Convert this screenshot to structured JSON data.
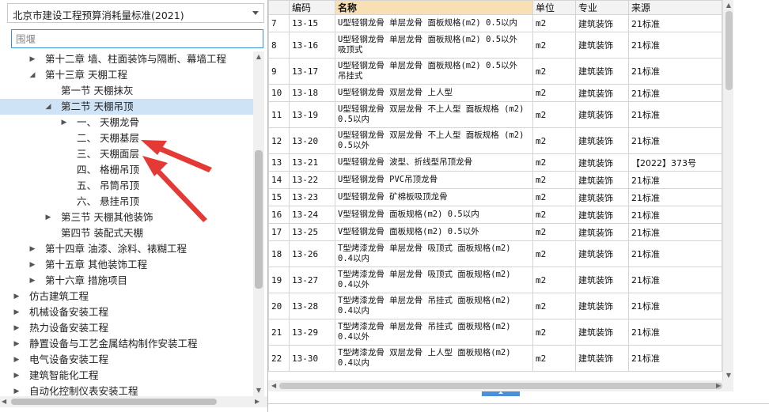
{
  "library_select": {
    "value": "北京市建设工程预算消耗量标准(2021)"
  },
  "search": {
    "placeholder": "围堰",
    "value": ""
  },
  "tree": {
    "items": [
      {
        "label": "第十二章 墙、柱面装饰与隔断、幕墙工程",
        "toggle": "▶",
        "selected": false
      },
      {
        "label": "第十三章 天棚工程",
        "toggle": "◢",
        "selected": false
      },
      {
        "label": "第一节 天棚抹灰",
        "toggle": "",
        "selected": false
      },
      {
        "label": "第二节 天棚吊顶",
        "toggle": "◢",
        "selected": true
      },
      {
        "label": "一、 天棚龙骨",
        "toggle": "▶",
        "selected": false
      },
      {
        "label": "二、 天棚基层",
        "toggle": "",
        "selected": false
      },
      {
        "label": "三、 天棚面层",
        "toggle": "",
        "selected": false
      },
      {
        "label": "四、 格栅吊顶",
        "toggle": "",
        "selected": false
      },
      {
        "label": "五、 吊筒吊顶",
        "toggle": "",
        "selected": false
      },
      {
        "label": "六、 悬挂吊顶",
        "toggle": "",
        "selected": false
      },
      {
        "label": "第三节 天棚其他装饰",
        "toggle": "▶",
        "selected": false
      },
      {
        "label": "第四节 装配式天棚",
        "toggle": "",
        "selected": false
      },
      {
        "label": "第十四章 油漆、涂料、裱糊工程",
        "toggle": "▶",
        "selected": false
      },
      {
        "label": "第十五章 其他装饰工程",
        "toggle": "▶",
        "selected": false
      },
      {
        "label": "第十六章 措施项目",
        "toggle": "▶",
        "selected": false
      },
      {
        "label": "仿古建筑工程",
        "toggle": "▶",
        "selected": false
      },
      {
        "label": "机械设备安装工程",
        "toggle": "▶",
        "selected": false
      },
      {
        "label": "热力设备安装工程",
        "toggle": "▶",
        "selected": false
      },
      {
        "label": "静置设备与工艺金属结构制作安装工程",
        "toggle": "▶",
        "selected": false
      },
      {
        "label": "电气设备安装工程",
        "toggle": "▶",
        "selected": false
      },
      {
        "label": "建筑智能化工程",
        "toggle": "▶",
        "selected": false
      },
      {
        "label": "自动化控制仪表安装工程",
        "toggle": "▶",
        "selected": false
      }
    ]
  },
  "table": {
    "headers": {
      "idx": "",
      "code": "编码",
      "name": "名称",
      "unit": "单位",
      "major": "专业",
      "source": "来源"
    },
    "rows": [
      {
        "idx": "7",
        "code": "13-15",
        "name": "U型轻钢龙骨 单层龙骨 面板规格(m2) 0.5以内",
        "unit": "m2",
        "major": "建筑装饰",
        "source": "21标准"
      },
      {
        "idx": "8",
        "code": "13-16",
        "name": "U型轻钢龙骨 单层龙骨 面板规格(m2) 0.5以外 吸顶式",
        "unit": "m2",
        "major": "建筑装饰",
        "source": "21标准"
      },
      {
        "idx": "9",
        "code": "13-17",
        "name": "U型轻钢龙骨 单层龙骨 面板规格(m2) 0.5以外 吊挂式",
        "unit": "m2",
        "major": "建筑装饰",
        "source": "21标准"
      },
      {
        "idx": "10",
        "code": "13-18",
        "name": "U型轻钢龙骨 双层龙骨 上人型",
        "unit": "m2",
        "major": "建筑装饰",
        "source": "21标准"
      },
      {
        "idx": "11",
        "code": "13-19",
        "name": "U型轻钢龙骨 双层龙骨 不上人型 面板规格 (m2) 0.5以内",
        "unit": "m2",
        "major": "建筑装饰",
        "source": "21标准"
      },
      {
        "idx": "12",
        "code": "13-20",
        "name": "U型轻钢龙骨 双层龙骨 不上人型 面板规格 (m2) 0.5以外",
        "unit": "m2",
        "major": "建筑装饰",
        "source": "21标准"
      },
      {
        "idx": "13",
        "code": "13-21",
        "name": "U型轻钢龙骨 波型、折线型吊顶龙骨",
        "unit": "m2",
        "major": "建筑装饰",
        "source": "【2022】373号"
      },
      {
        "idx": "14",
        "code": "13-22",
        "name": "U型轻钢龙骨 PVC吊顶龙骨",
        "unit": "m2",
        "major": "建筑装饰",
        "source": "21标准"
      },
      {
        "idx": "15",
        "code": "13-23",
        "name": "U型轻钢龙骨 矿棉板吸顶龙骨",
        "unit": "m2",
        "major": "建筑装饰",
        "source": "21标准"
      },
      {
        "idx": "16",
        "code": "13-24",
        "name": "V型轻钢龙骨 面板规格(m2) 0.5以内",
        "unit": "m2",
        "major": "建筑装饰",
        "source": "21标准"
      },
      {
        "idx": "17",
        "code": "13-25",
        "name": "V型轻钢龙骨 面板规格(m2) 0.5以外",
        "unit": "m2",
        "major": "建筑装饰",
        "source": "21标准"
      },
      {
        "idx": "18",
        "code": "13-26",
        "name": "T型烤漆龙骨 单层龙骨 吸顶式 面板规格(m2) 0.4以内",
        "unit": "m2",
        "major": "建筑装饰",
        "source": "21标准"
      },
      {
        "idx": "19",
        "code": "13-27",
        "name": "T型烤漆龙骨 单层龙骨 吸顶式 面板规格(m2) 0.4以外",
        "unit": "m2",
        "major": "建筑装饰",
        "source": "21标准"
      },
      {
        "idx": "20",
        "code": "13-28",
        "name": "T型烤漆龙骨 单层龙骨 吊挂式 面板规格(m2) 0.4以内",
        "unit": "m2",
        "major": "建筑装饰",
        "source": "21标准"
      },
      {
        "idx": "21",
        "code": "13-29",
        "name": "T型烤漆龙骨 单层龙骨 吊挂式 面板规格(m2) 0.4以外",
        "unit": "m2",
        "major": "建筑装饰",
        "source": "21标准"
      },
      {
        "idx": "22",
        "code": "13-30",
        "name": "T型烤漆龙骨 双层龙骨 上人型 面板规格(m2) 0.4以内",
        "unit": "m2",
        "major": "建筑装饰",
        "source": "21标准"
      }
    ]
  },
  "colors": {
    "selection": "#cfe3f6",
    "name_header": "#f9e0b4",
    "annotation_arrow": "#e53935",
    "splitter": "#4a8fd8"
  }
}
